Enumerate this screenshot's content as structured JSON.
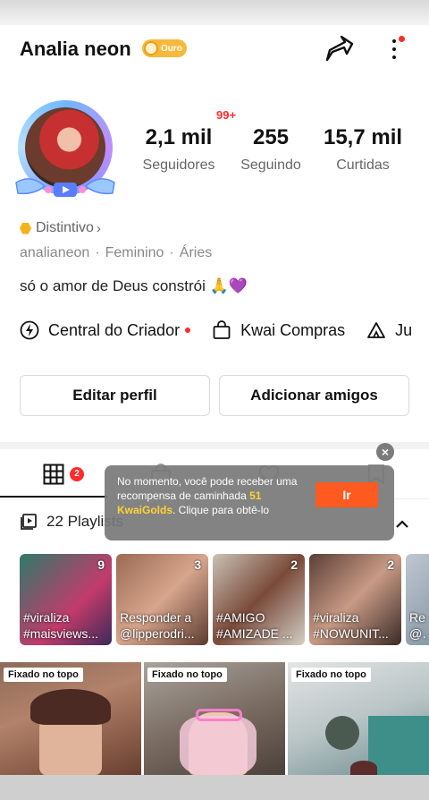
{
  "profile": {
    "name": "Analia neon",
    "level_badge": "Ouro",
    "notification_count": "99+",
    "distintivo": "Distintivo",
    "username": "analianeon",
    "gender": "Feminino",
    "sign": "Áries",
    "bio": "só o amor de Deus constrói 🙏💜"
  },
  "stats": [
    {
      "value": "2,1 mil",
      "label": "Seguidores"
    },
    {
      "value": "255",
      "label": "Seguindo"
    },
    {
      "value": "15,7 mil",
      "label": "Curtidas"
    }
  ],
  "tools": {
    "creator_center": "Central do Criador",
    "kwai_shop": "Kwai Compras",
    "third_partial": "Ju"
  },
  "buttons": {
    "edit_profile": "Editar perfil",
    "add_friends": "Adicionar amigos"
  },
  "tabs": {
    "works_badge": "2"
  },
  "playlists": {
    "label": "22 Playlists",
    "items": [
      {
        "count": "9",
        "caption_1": "#viraliza",
        "caption_2": "#maisviews..."
      },
      {
        "count": "3",
        "caption_1": "Responder a",
        "caption_2": "@lipperodri..."
      },
      {
        "count": "2",
        "caption_1": "#AMIGO",
        "caption_2": "#AMIZADE ..."
      },
      {
        "count": "2",
        "caption_1": "#viraliza",
        "caption_2": "#NOWUNIT..."
      },
      {
        "count": "",
        "caption_1": "Re",
        "caption_2": "@a"
      }
    ]
  },
  "videos": [
    {
      "pin": "Fixado no topo"
    },
    {
      "pin": "Fixado no topo"
    },
    {
      "pin": "Fixado no topo"
    }
  ],
  "toast": {
    "text_1": "No momento, você pode receber uma recompensa de caminhada ",
    "highlight": "51 KwaiGolds",
    "text_2": ". Clique para obtê-lo",
    "button": "Ir",
    "close": "×"
  },
  "colors": {
    "accent": "#ff5a1f",
    "badge_red": "#ff2b2b",
    "gold": "#f6b93b",
    "highlight_yellow": "#ffd233"
  },
  "icons": [
    "share-icon",
    "more-vertical-icon",
    "lightning-icon",
    "shopping-bag-icon",
    "grid-icon",
    "bag-icon",
    "heart-icon",
    "bookmark-icon",
    "playlist-icon",
    "chevron-up-icon"
  ]
}
